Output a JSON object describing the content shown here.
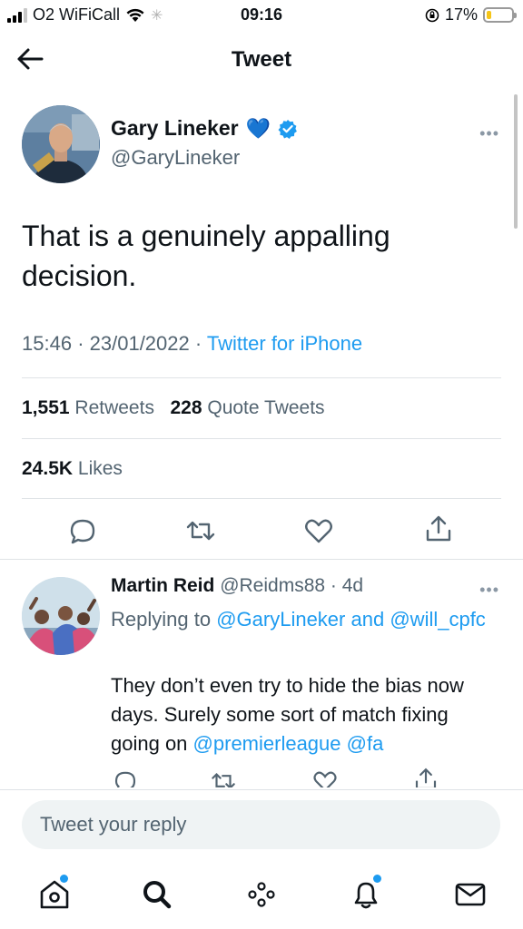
{
  "status_bar": {
    "carrier": "O2 WiFiCall",
    "time": "09:16",
    "battery": "17%",
    "battery_level": 0.17
  },
  "header": {
    "title": "Tweet"
  },
  "tweet": {
    "author_name": "Gary Lineker",
    "name_emoji": "💙",
    "handle": "@GaryLineker",
    "text": "That is a genuinely appalling decision.",
    "time": "15:46",
    "date": "23/01/2022",
    "source": "Twitter for iPhone",
    "retweets_count": "1,551",
    "retweets_label": "Retweets",
    "quotes_count": "228",
    "quotes_label": "Quote Tweets",
    "likes_count": "24.5K",
    "likes_label": "Likes"
  },
  "reply": {
    "author_name": "Martin Reid",
    "handle": "@Reidms88",
    "age": "4d",
    "replying_prefix": "Replying to",
    "replying_to_1": "@GaryLineker",
    "replying_and": "and",
    "replying_to_2": "@will_cpfc",
    "text": "They don’t even try to hide the bias now days. Surely some sort of match fixing going on",
    "mention_1": "@premierleague",
    "mention_2": "@fa"
  },
  "composer": {
    "placeholder": "Tweet your reply"
  },
  "colors": {
    "accent": "#1d9bf0",
    "secondary_text": "#536471",
    "battery_fill": "#f5c518"
  },
  "tabs": [
    "home-icon",
    "search-icon",
    "spaces-icon",
    "notifications-icon",
    "messages-icon"
  ]
}
